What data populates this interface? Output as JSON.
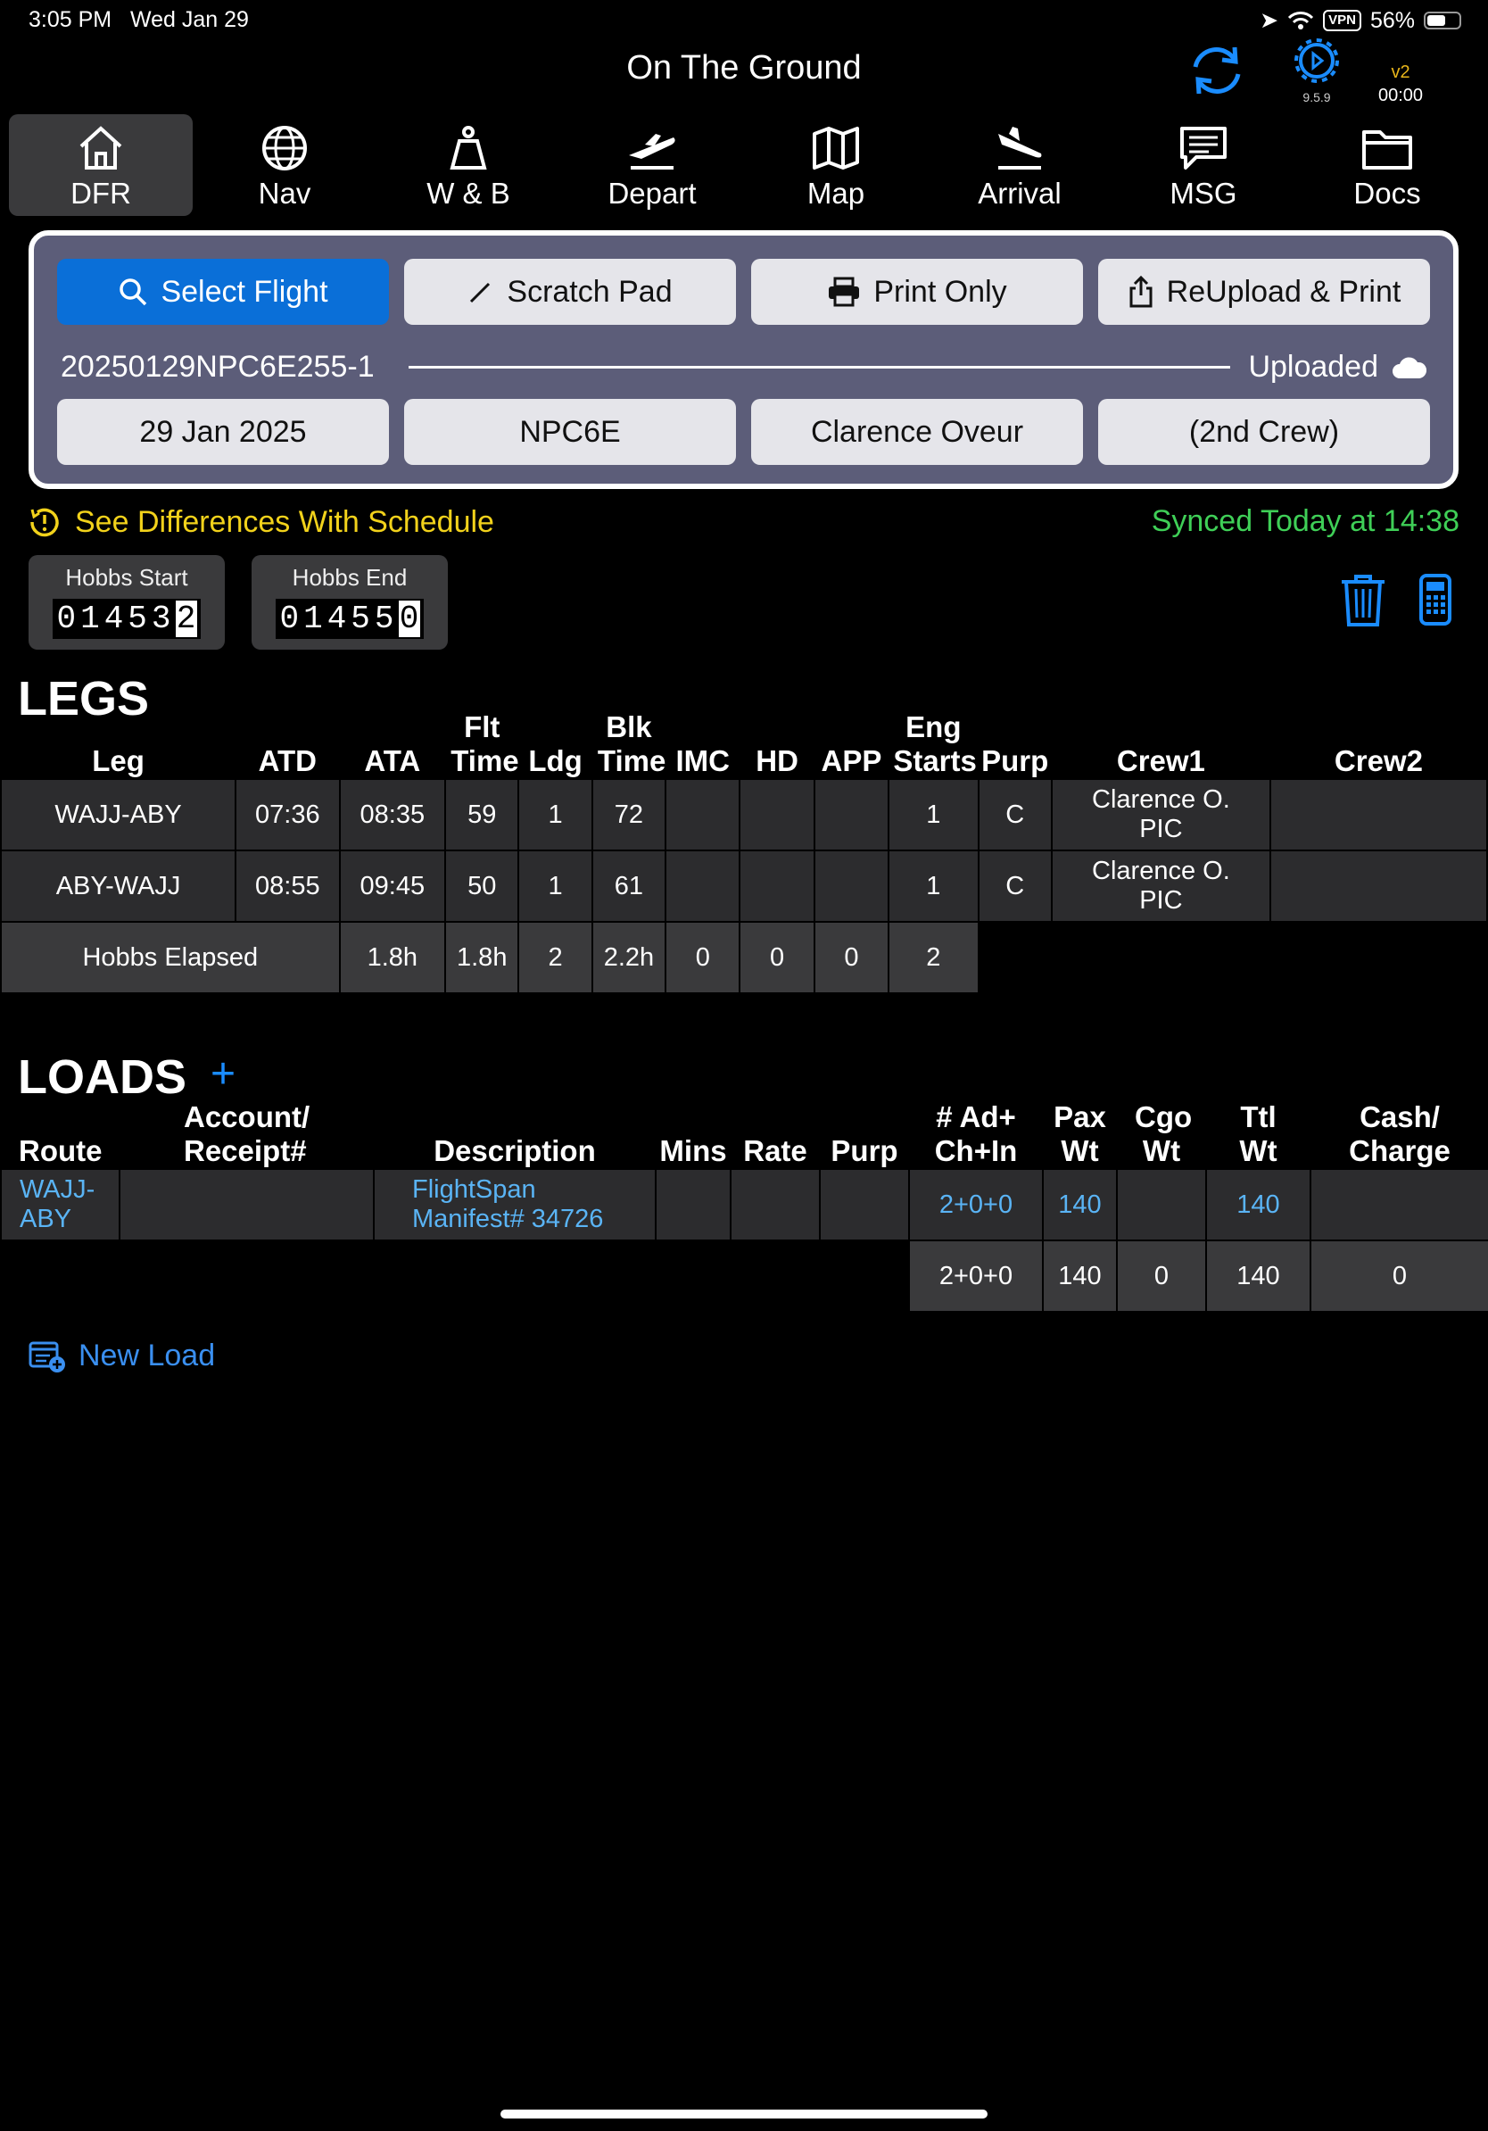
{
  "status": {
    "time": "3:05 PM",
    "date": "Wed Jan 29",
    "vpn": "VPN",
    "battery": "56%"
  },
  "header": {
    "title": "On The Ground",
    "app_version": "9.5.9",
    "version_label": "v2",
    "timer": "00:00"
  },
  "tabs": [
    {
      "label": "DFR",
      "icon": "home-icon",
      "active": true
    },
    {
      "label": "Nav",
      "icon": "globe-icon"
    },
    {
      "label": "W & B",
      "icon": "scale-icon"
    },
    {
      "label": "Depart",
      "icon": "takeoff-icon"
    },
    {
      "label": "Map",
      "icon": "map-icon"
    },
    {
      "label": "Arrival",
      "icon": "landing-icon"
    },
    {
      "label": "MSG",
      "icon": "message-icon"
    },
    {
      "label": "Docs",
      "icon": "folder-icon"
    }
  ],
  "panel": {
    "select_flight": "Select Flight",
    "scratch_pad": "Scratch Pad",
    "print_only": "Print Only",
    "reupload_print": "ReUpload & Print",
    "flight_id": "20250129NPC6E255-1",
    "upload_status": "Uploaded",
    "date": "29 Jan 2025",
    "aircraft": "NPC6E",
    "crew": "Clarence Oveur",
    "second_crew": "(2nd Crew)"
  },
  "alerts": {
    "differences": "See Differences With Schedule",
    "synced": "Synced Today at 14:38"
  },
  "hobbs": {
    "start_label": "Hobbs Start",
    "start_digits": "01453",
    "start_last": "2",
    "end_label": "Hobbs End",
    "end_digits": "01455",
    "end_last": "0"
  },
  "legs": {
    "title": "LEGS",
    "headers": [
      "Leg",
      "ATD",
      "ATA",
      "Flt Time",
      "Ldg",
      "Blk Time",
      "IMC",
      "HD",
      "APP",
      "Eng Starts",
      "Purp",
      "Crew1",
      "Crew2"
    ],
    "rows": [
      [
        "WAJJ-ABY",
        "07:36",
        "08:35",
        "59",
        "1",
        "72",
        "",
        "",
        "",
        "1",
        "C",
        "Clarence O.\nPIC",
        ""
      ],
      [
        "ABY-WAJJ",
        "08:55",
        "09:45",
        "50",
        "1",
        "61",
        "",
        "",
        "",
        "1",
        "C",
        "Clarence O.\nPIC",
        ""
      ]
    ],
    "totals_label": "Hobbs Elapsed",
    "totals": [
      "1.8h",
      "1.8h",
      "2",
      "2.2h",
      "0",
      "0",
      "0",
      "2"
    ]
  },
  "loads": {
    "title": "LOADS",
    "add": "+",
    "headers": [
      "Route",
      "Account/ Receipt#",
      "Description",
      "Mins",
      "Rate",
      "Purp",
      "# Ad+ Ch+In",
      "Pax Wt",
      "Cgo Wt",
      "Ttl Wt",
      "Cash/ Charge"
    ],
    "rows": [
      [
        "WAJJ-\nABY",
        "",
        "FlightSpan\nManifest# 34726",
        "",
        "",
        "",
        "2+0+0",
        "140",
        "",
        "140",
        ""
      ]
    ],
    "totals": [
      "2+0+0",
      "140",
      "0",
      "140",
      "0"
    ],
    "new_load": "New Load"
  },
  "colors": {
    "accent": "#0a6fd8",
    "warning": "#f2d21b",
    "success": "#3fcf57",
    "link": "#5ab4f5"
  }
}
